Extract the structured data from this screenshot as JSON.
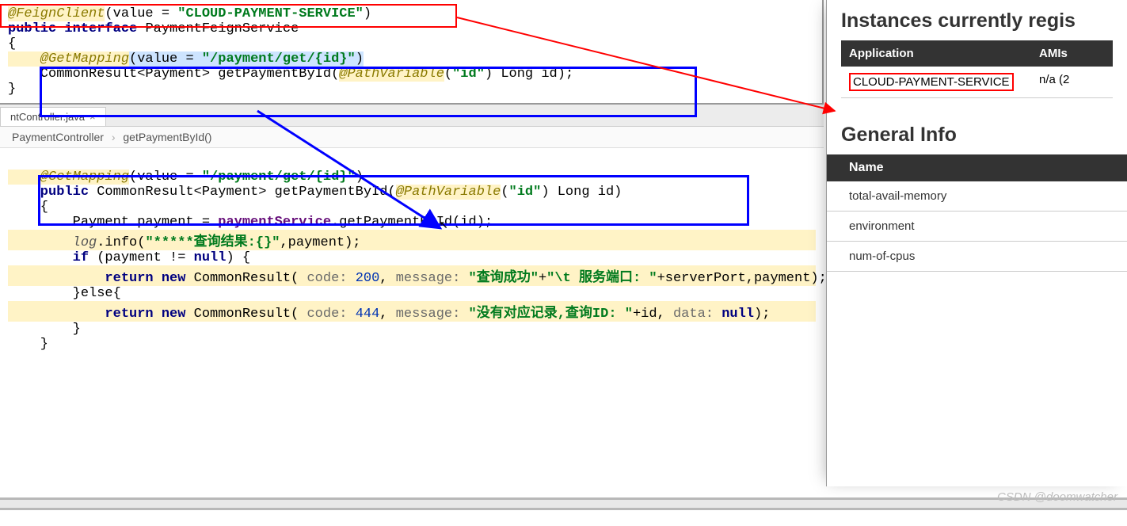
{
  "top_code": {
    "l1a": "@FeignClient",
    "l1b": "(value = ",
    "l1c": "\"CLOUD-PAYMENT-SERVICE\"",
    "l1d": ")",
    "l2a": "public interface ",
    "l2b": "PaymentFeignService",
    "l3": "{",
    "l4a": "    @GetMapping",
    "l4b": "(value = ",
    "l4c": "\"/payment/get/{id}\"",
    "l4d": ")",
    "l5a": "    CommonResult<Payment> getPaymentById(",
    "l5b": "@PathVariable",
    "l5c": "(",
    "l5d": "\"id\"",
    "l5e": ") Long id);",
    "l6": "}"
  },
  "tab": {
    "name": "ntController.java"
  },
  "breadcrumb": {
    "class": "PaymentController",
    "method": "getPaymentById()"
  },
  "bottom_code": {
    "b0": " ",
    "b1a": "    @GetMapping",
    "b1b": "(value = ",
    "b1c": "\"/payment/get/{id}\"",
    "b1d": ")",
    "b2a": "    public ",
    "b2b": "CommonResult<Payment> getPaymentById(",
    "b2c": "@PathVariable",
    "b2d": "(",
    "b2e": "\"id\"",
    "b2f": ") Long id)",
    "b3": "    {",
    "b4a": "        Payment payment = ",
    "b4b": "paymentService",
    "b4c": ".getPaymentById(id);",
    "b5a": "        ",
    "b5b": "log",
    "b5c": ".info(",
    "b5d": "\"*****查询结果:{}\"",
    "b5e": ",payment);",
    "b6a": "        if ",
    "b6b": "(payment != ",
    "b6c": "null",
    "b6d": ") {",
    "b7a": "            return new ",
    "b7b": "CommonResult( ",
    "b7c": "code: ",
    "b7d": "200",
    "b7e": ", ",
    "b7f": "message: ",
    "b7g": "\"查询成功\"",
    "b7h": "+",
    "b7i": "\"\\t 服务端口: \"",
    "b7j": "+serverPort,payment);",
    "b8": "        }else{",
    "b9a": "            return new ",
    "b9b": "CommonResult( ",
    "b9c": "code: ",
    "b9d": "444",
    "b9e": ", ",
    "b9f": "message: ",
    "b9g": "\"没有对应记录,查询ID: \"",
    "b9h": "+id, ",
    "b9i": "data: ",
    "b9j": "null",
    "b9k": ");",
    "b10": "        }",
    "b11": "    }"
  },
  "right": {
    "heading1": "Instances currently regis",
    "colApp": "Application",
    "colAmi": "AMIs",
    "serviceName": "CLOUD-PAYMENT-SERVICE",
    "ami": "n/a (2",
    "heading2": "General Info",
    "colName": "Name",
    "rows": [
      "total-avail-memory",
      "environment",
      "num-of-cpus"
    ]
  },
  "watermark": "CSDN @doomwatcher"
}
